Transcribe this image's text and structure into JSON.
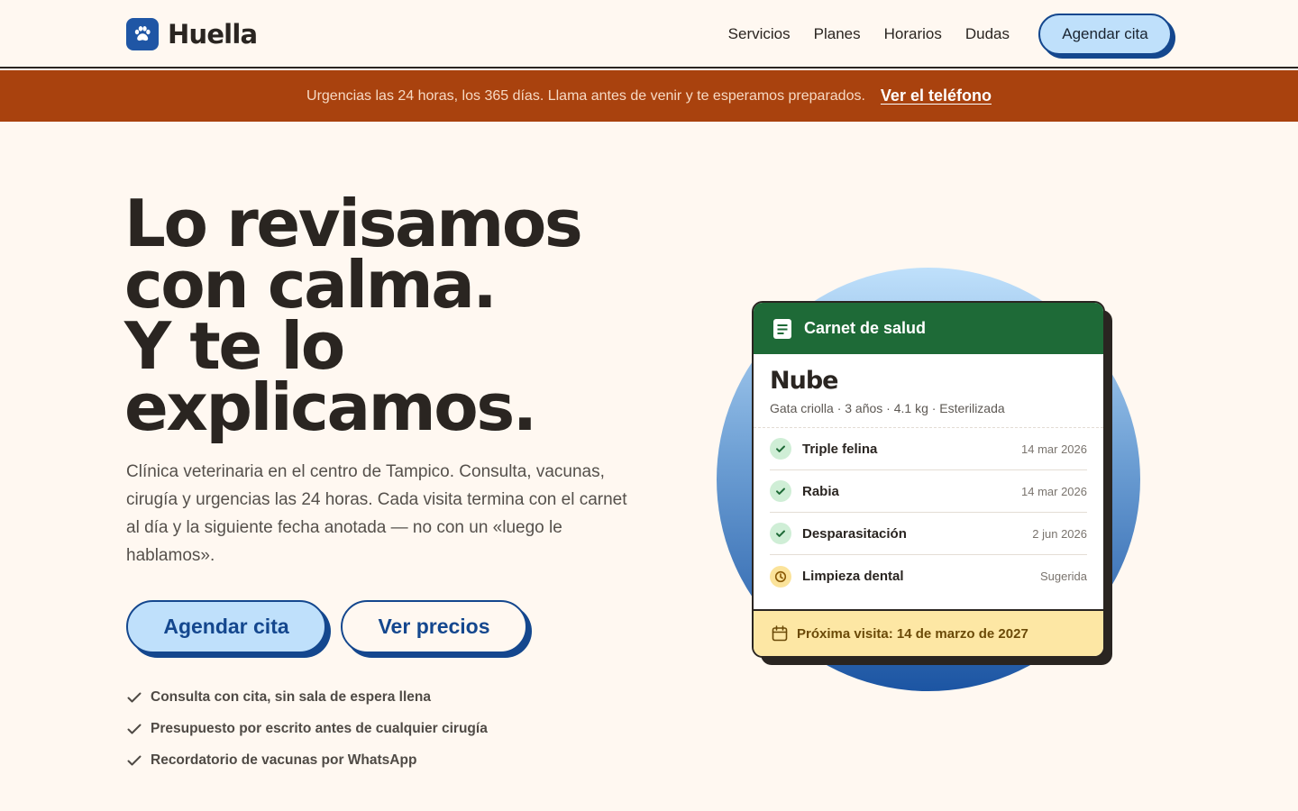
{
  "brand": {
    "name": "Huella"
  },
  "nav": {
    "links": [
      "Servicios",
      "Planes",
      "Horarios",
      "Dudas"
    ],
    "cta": "Agendar cita"
  },
  "banner": {
    "text": "Urgencias las 24 horas, los 365 días. Llama antes de venir y te esperamos preparados.",
    "link": "Ver el teléfono"
  },
  "hero": {
    "title_lines": [
      "Lo revisamos",
      "con calma.",
      "Y te lo",
      "explicamos."
    ],
    "description": "Clínica veterinaria en el centro de Tampico. Consulta, vacunas, cirugía y urgencias las 24 horas. Cada visita termina con el carnet al día y la siguiente fecha anotada — no con un «luego le hablamos».",
    "primary_cta": "Agendar cita",
    "secondary_cta": "Ver precios",
    "features": [
      "Consulta con cita, sin sala de espera llena",
      "Presupuesto por escrito antes de cualquier cirugía",
      "Recordatorio de vacunas por WhatsApp"
    ]
  },
  "card": {
    "title": "Carnet de salud",
    "pet_name": "Nube",
    "pet_meta": "Gata criolla · 3 años · 4.1 kg · Esterilizada",
    "records": [
      {
        "name": "Triple felina",
        "date": "14 mar 2026",
        "status": "done"
      },
      {
        "name": "Rabia",
        "date": "14 mar 2026",
        "status": "done"
      },
      {
        "name": "Desparasitación",
        "date": "2 jun 2026",
        "status": "done"
      },
      {
        "name": "Limpieza dental",
        "date": "Sugerida",
        "status": "suggested"
      }
    ],
    "next_visit": "Próxima visita: 14 de marzo de 2027"
  },
  "colors": {
    "background": "#fff8f1",
    "primary_blue": "#14478e",
    "light_blue": "#bfe0fb",
    "banner_orange": "#a9420e",
    "card_green": "#1e6a37",
    "footer_yellow": "#fde7a4"
  },
  "icons": {
    "logo": "paw-icon",
    "card_header": "document-icon",
    "done": "check-icon",
    "suggested": "clock-icon",
    "footer": "calendar-icon",
    "feature": "check-icon"
  }
}
